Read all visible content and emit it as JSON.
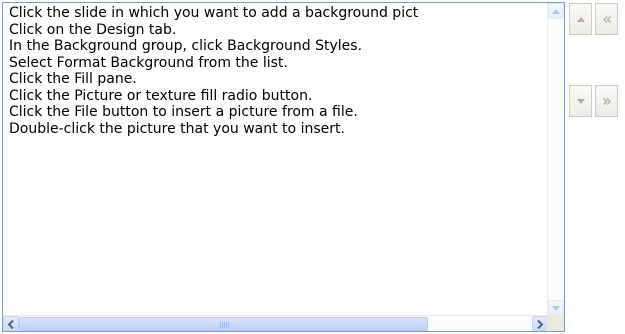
{
  "steps": [
    "Click the slide in which you want to add a background pict",
    "Click on the Design tab.",
    "In the Background group, click Background Styles.",
    "Select Format Background from the list.",
    "Click the Fill pane.",
    "Click the Picture or texture fill radio button.",
    "Click the File button to insert a picture from a file.",
    "Double-click the picture that you want to insert."
  ],
  "buttons": {
    "move_up_icon": "triangle-up-icon",
    "move_top_icon": "double-chevron-left-icon",
    "move_down_icon": "triangle-down-icon",
    "move_bottom_icon": "double-chevron-right-icon"
  },
  "colors": {
    "list_border": "#7f9db9",
    "scroll_button": "#c7d8fc",
    "nav_button_border": "#cfcbbd",
    "nav_icon": "#b0ad9f"
  }
}
